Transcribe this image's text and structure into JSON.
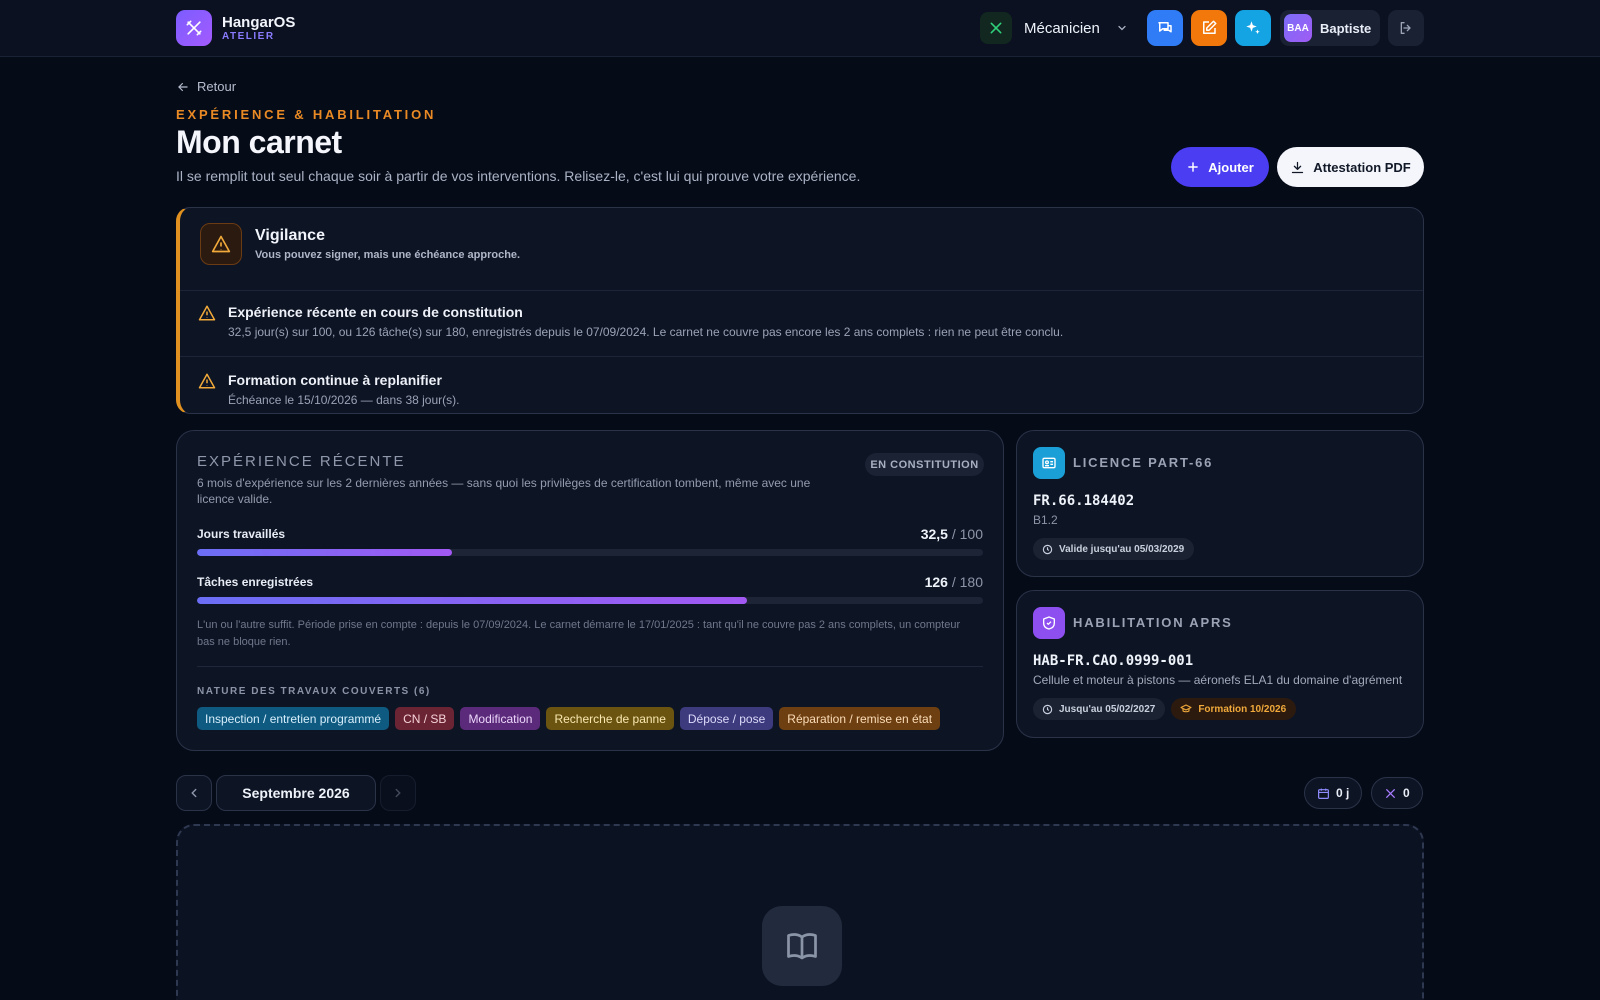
{
  "app": {
    "name": "HangarOS",
    "subtitle": "ATELIER"
  },
  "topbar": {
    "role": "Mécanicien",
    "user_initials": "BAA",
    "user_name": "Baptiste"
  },
  "header": {
    "back_label": "Retour",
    "eyebrow": "EXPÉRIENCE & HABILITATION",
    "title": "Mon carnet",
    "subtitle": "Il se remplit tout seul chaque soir à partir de vos interventions. Relisez-le, c'est lui qui prouve votre expérience.",
    "add_label": "Ajouter",
    "pdf_label": "Attestation PDF"
  },
  "vigilance": {
    "title": "Vigilance",
    "description": "Vous pouvez signer, mais une échéance approche.",
    "items": [
      {
        "title": "Expérience récente en cours de constitution",
        "description": "32,5 jour(s) sur 100, ou 126 tâche(s) sur 180, enregistrés depuis le 07/09/2024. Le carnet ne couvre pas encore les 2 ans complets : rien ne peut être conclu."
      },
      {
        "title": "Formation continue à replanifier",
        "description": "Échéance le 15/10/2026 — dans 38 jour(s)."
      }
    ]
  },
  "experience": {
    "title": "EXPÉRIENCE RÉCENTE",
    "badge": "EN CONSTITUTION",
    "description": "6 mois d'expérience sur les 2 dernières années — sans quoi les privilèges de certification tombent, même avec une licence valide.",
    "days": {
      "label": "Jours travaillés",
      "value": "32,5",
      "target": "/ 100",
      "progress": 0.325
    },
    "tasks": {
      "label": "Tâches enregistrées",
      "value": "126",
      "target": "/ 180",
      "progress": 0.7
    },
    "note": "L'un ou l'autre suffit. Période prise en compte : depuis le 07/09/2024. Le carnet démarre le 17/01/2025 : tant qu'il ne couvre pas 2 ans complets, un compteur bas ne bloque rien.",
    "nature_title": "NATURE DES TRAVAUX COUVERTS (6)",
    "natures": [
      {
        "label": "Inspection / entretien programmé",
        "bg": "#0f5a80",
        "fg": "#d7eefc"
      },
      {
        "label": "CN / SB",
        "bg": "#6b2434",
        "fg": "#f5d2d8"
      },
      {
        "label": "Modification",
        "bg": "#5b2a7a",
        "fg": "#ecd6fb"
      },
      {
        "label": "Recherche de panne",
        "bg": "#6a5410",
        "fg": "#f9e7b0"
      },
      {
        "label": "Dépose / pose",
        "bg": "#3d3a7e",
        "fg": "#dcdaf9"
      },
      {
        "label": "Réparation / remise en état",
        "bg": "#6e3f10",
        "fg": "#fbdcb8"
      }
    ]
  },
  "licence": {
    "title": "LICENCE PART-66",
    "id": "FR.66.184402",
    "category": "B1.2",
    "validity": "Valide jusqu'au 05/03/2029"
  },
  "aprs": {
    "title": "HABILITATION APRS",
    "id": "HAB-FR.CAO.0999-001",
    "scope": "Cellule et moteur à pistons — aéronefs ELA1 du domaine d'agrément",
    "validity": "Jusqu'au 05/02/2027",
    "training": "Formation 10/2026"
  },
  "period": {
    "month": "Septembre 2026",
    "days": "0 j",
    "tasks": "0"
  },
  "colors": {
    "accent": "#4a3df2",
    "warning": "#e0911f",
    "background": "#060b18"
  }
}
